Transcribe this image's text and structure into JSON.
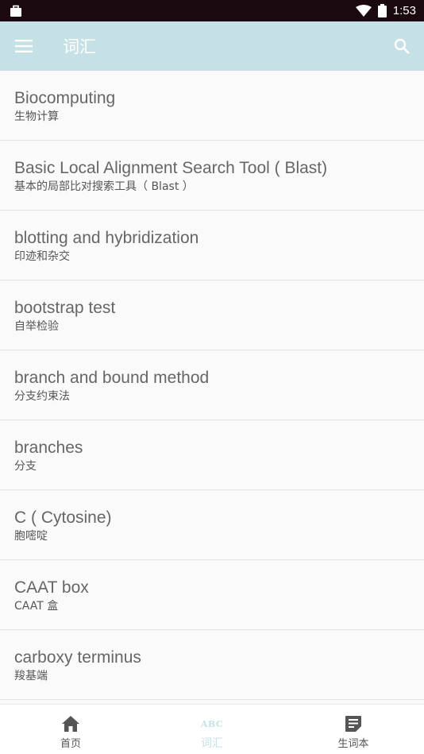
{
  "status": {
    "time": "1:53"
  },
  "appbar": {
    "title": "词汇"
  },
  "colors": {
    "accent": "#c5e1e6",
    "statusbar": "#1a0a10"
  },
  "words": [
    {
      "term": "Biocomputing",
      "translation": "生物计算"
    },
    {
      "term": "Basic Local Alignment Search Tool ( Blast)",
      "translation": "基本的局部比对搜索工具（ Blast ）"
    },
    {
      "term": "blotting and hybridization",
      "translation": "印迹和杂交"
    },
    {
      "term": "bootstrap test",
      "translation": "自举检验"
    },
    {
      "term": "branch and bound method",
      "translation": "分支约束法"
    },
    {
      "term": "branches",
      "translation": "分支"
    },
    {
      "term": "C ( Cytosine)",
      "translation": "胞嘧啶"
    },
    {
      "term": "CAAT box",
      "translation": "CAAT 盒"
    },
    {
      "term": "carboxy terminus",
      "translation": "羧基端"
    }
  ],
  "bottom_nav": {
    "home": {
      "label": "首页",
      "icon": "home-icon"
    },
    "vocab": {
      "label": "词汇",
      "icon": "abc-icon",
      "icon_text": "ABC"
    },
    "wordbook": {
      "label": "生词本",
      "icon": "note-icon"
    }
  }
}
